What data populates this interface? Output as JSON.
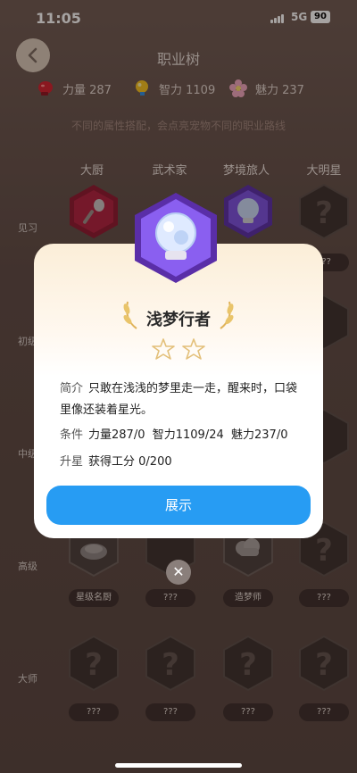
{
  "status": {
    "time": "11:05",
    "network": "5G",
    "battery": "90"
  },
  "header": {
    "title": "职业树"
  },
  "stats": [
    {
      "icon": "boxing-glove-icon",
      "label": "力量 287"
    },
    {
      "icon": "lightbulb-icon",
      "label": "智力 1109"
    },
    {
      "icon": "flower-icon",
      "label": "魅力 237"
    }
  ],
  "hint": "不同的属性搭配，会点亮宠物不同的职业路线",
  "columns": [
    "大厨",
    "武术家",
    "梦境旅人",
    "大明星"
  ],
  "rows": {
    "r1": "见习",
    "r2": "初级",
    "r3": "中级",
    "r4": "高级",
    "r5": "大师"
  },
  "pills": {
    "row1_col4": "???",
    "row4": [
      "星级名厨",
      "???",
      "造梦师",
      "???"
    ],
    "row5": [
      "???",
      "???",
      "???",
      "???"
    ]
  },
  "unknown_mark": "?",
  "modal": {
    "title": "浅梦行者",
    "intro_label": "简介",
    "intro_text": "只敢在浅浅的梦里走一走，醒来时，口袋里像还装着星光。",
    "cond_label": "条件",
    "cond_text": "力量287/0  智力1109/24  魅力237/0",
    "upgrade_label": "升星",
    "upgrade_text": "获得工分 0/200",
    "button": "展示",
    "stars_total": 2,
    "stars_filled": 0
  },
  "colors": {
    "accent": "#279cf3",
    "purple": "#7b4fe0",
    "red": "#b11f3e"
  }
}
